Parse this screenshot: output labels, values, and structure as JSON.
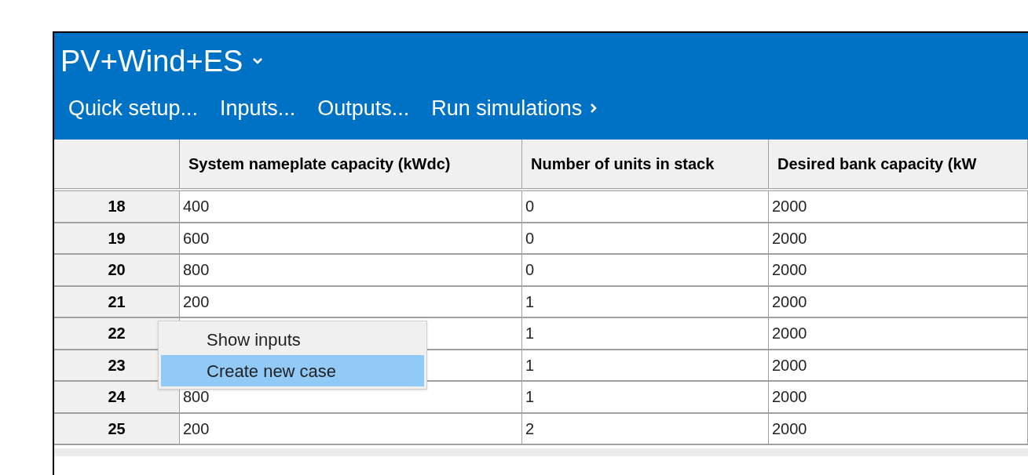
{
  "window": {
    "title": "PV+Wind+ES"
  },
  "toolbar": [
    {
      "label": "Quick setup...",
      "kind": "menu"
    },
    {
      "label": "Inputs...",
      "kind": "menu"
    },
    {
      "label": "Outputs...",
      "kind": "menu"
    },
    {
      "label": "Run simulations",
      "kind": "run"
    }
  ],
  "table": {
    "columns": [
      "System nameplate capacity (kWdc)",
      "Number of units in stack",
      "Desired bank capacity (kW"
    ],
    "rows": [
      {
        "number": "18",
        "cells": [
          "400",
          "0",
          "2000"
        ]
      },
      {
        "number": "19",
        "cells": [
          "600",
          "0",
          "2000"
        ]
      },
      {
        "number": "20",
        "cells": [
          "800",
          "0",
          "2000"
        ]
      },
      {
        "number": "21",
        "cells": [
          "200",
          "1",
          "2000"
        ]
      },
      {
        "number": "22",
        "cells": [
          null,
          "1",
          "2000"
        ]
      },
      {
        "number": "23",
        "cells": [
          null,
          "1",
          "2000"
        ]
      },
      {
        "number": "24",
        "cells": [
          "800",
          "1",
          "2000"
        ]
      },
      {
        "number": "25",
        "cells": [
          "200",
          "2",
          "2000"
        ]
      }
    ]
  },
  "context_menu": {
    "items": [
      {
        "label": "Show inputs",
        "selected": false
      },
      {
        "label": "Create new case",
        "selected": true
      }
    ]
  }
}
